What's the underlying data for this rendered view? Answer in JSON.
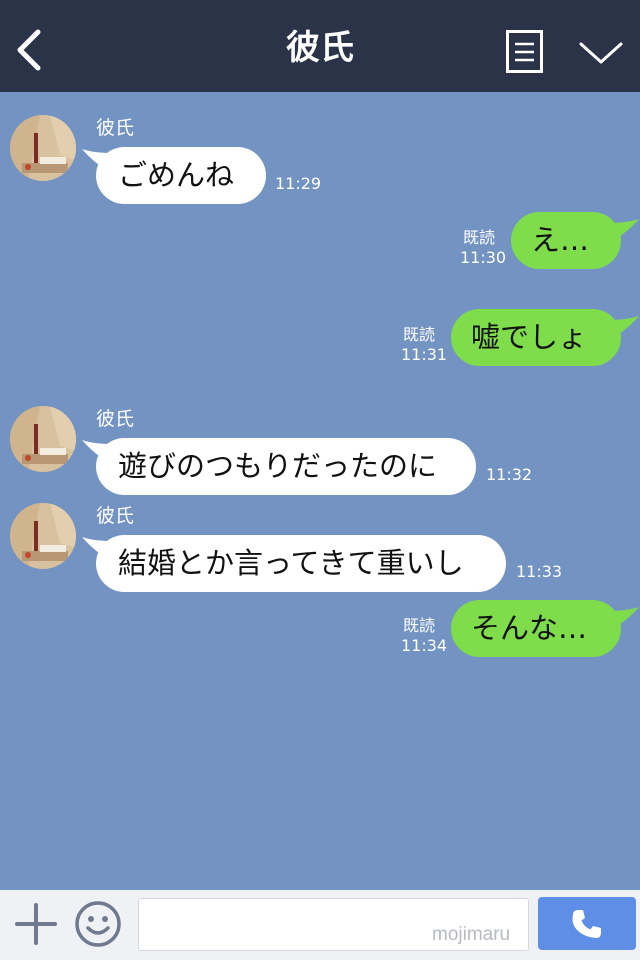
{
  "header": {
    "title": "彼氏"
  },
  "messages": [
    {
      "sender": "彼氏",
      "text": "ごめんね",
      "time": "11:29"
    },
    {
      "read": "既読",
      "text": "え…",
      "time": "11:30"
    },
    {
      "read": "既読",
      "text": "嘘でしょ",
      "time": "11:31"
    },
    {
      "sender": "彼氏",
      "text": "遊びのつもりだったのに",
      "time": "11:32"
    },
    {
      "sender": "彼氏",
      "text": "結婚とか言ってきて重いし",
      "time": "11:33"
    },
    {
      "read": "既読",
      "text": "そんな…",
      "time": "11:34"
    }
  ],
  "footer": {
    "input_value": "",
    "watermark": "mojimaru"
  },
  "colors": {
    "header_bg": "#2a3347",
    "chat_bg": "#7394c2",
    "outgoing_bubble": "#7fdc4a",
    "incoming_bubble": "#ffffff",
    "call_button": "#5f8ee6"
  },
  "icons": [
    "back-chevron-icon",
    "menu-list-icon",
    "chevron-down-icon",
    "plus-icon",
    "emoji-icon",
    "phone-icon"
  ]
}
